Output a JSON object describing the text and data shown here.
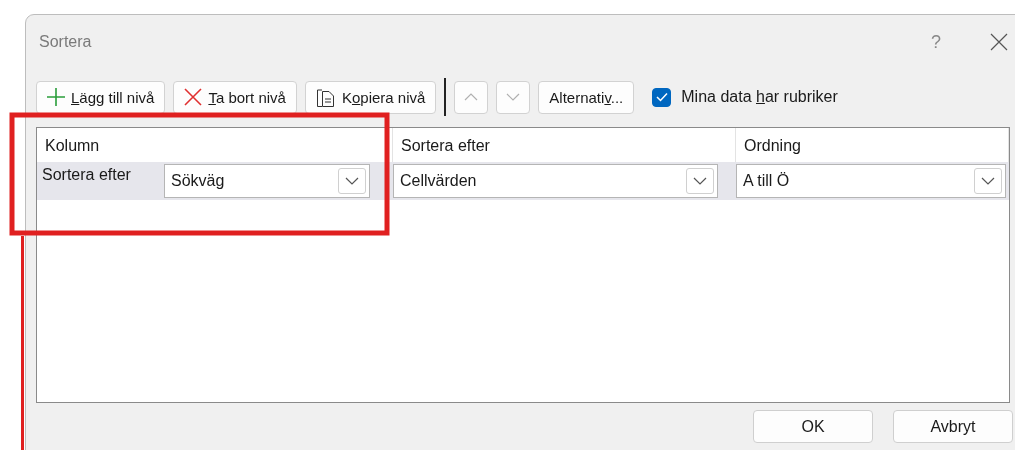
{
  "window": {
    "title": "Sortera",
    "help": "?"
  },
  "toolbar": [
    {
      "kind": "add",
      "key": "L",
      "post": "ägg till nivå"
    },
    {
      "kind": "delete",
      "key": "T",
      "post": "a bort nivå"
    },
    {
      "kind": "copy",
      "pre": "K",
      "key": "o",
      "post": "piera nivå"
    },
    {
      "kind": "up",
      "disabled": true
    },
    {
      "kind": "down",
      "disabled": true
    },
    {
      "kind": "text",
      "pre": "Alternati",
      "key": "v",
      "post": "..."
    }
  ],
  "headers_checkbox": {
    "pre": "Mina data ",
    "key": "h",
    "post": "ar rubriker",
    "checked": true
  },
  "table": {
    "columns": [
      "Kolumn",
      "Sortera efter",
      "Ordning"
    ],
    "rows": [
      {
        "label": "Sortera efter",
        "selected": true,
        "cells": [
          "Sökväg",
          "Cellvärden",
          "A till Ö"
        ]
      }
    ]
  },
  "buttons": [
    "OK",
    "Avbryt"
  ]
}
